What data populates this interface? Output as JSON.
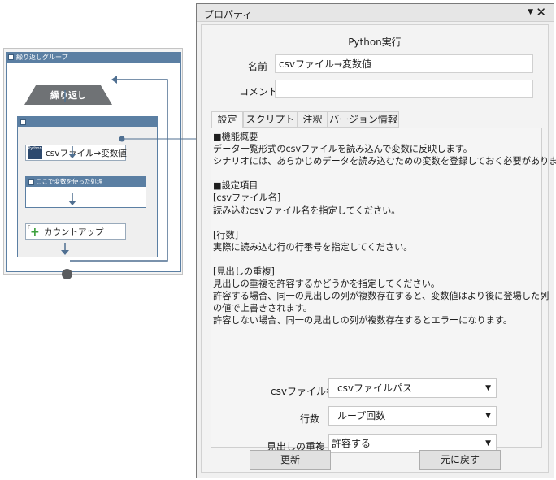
{
  "flow": {
    "group_title": "繰り返しグループ",
    "loop_label": "繰り返し",
    "python_icon_label": "Python",
    "csv_node_label": "csvファイル→変数値",
    "sub_block_title": "ここで変数を使った処理",
    "count_node_label": "カウントアップ"
  },
  "panel": {
    "title": "プロパティ",
    "dropdown_icon": "▼",
    "close_icon": "✕",
    "action_name": "Python実行",
    "name_label": "名前",
    "name_value": "csvファイル→変数値",
    "comment_label": "コメント",
    "comment_value": ""
  },
  "tabs": [
    {
      "label": "設定",
      "active": true
    },
    {
      "label": "スクリプト",
      "active": false
    },
    {
      "label": "注釈",
      "active": false
    },
    {
      "label": "バージョン情報",
      "active": false
    }
  ],
  "description": [
    "■機能概要",
    "データ一覧形式のcsvファイルを読み込んで変数に反映します。",
    "シナリオには、あらかじめデータを読み込むための変数を登録しておく必要があります。",
    "",
    "■設定項目",
    "[csvファイル名]",
    "読み込むcsvファイル名を指定してください。",
    "",
    "[行数]",
    "実際に読み込む行の行番号を指定してください。",
    "",
    "[見出しの重複]",
    "見出しの重複を許容するかどうかを指定してください。",
    "許容する場合、同一の見出しの列が複数存在すると、変数値はより後に登場した列",
    "の値で上書きされます。",
    "許容しない場合、同一の見出しの列が複数存在するとエラーになります。"
  ],
  "settings": {
    "csv_label": "csvファイル名",
    "csv_value": "csvファイルパス",
    "rows_label": "行数",
    "rows_value": "ループ回数",
    "dup_label": "見出しの重複",
    "dup_value": "許容する",
    "caret": "▼"
  },
  "buttons": {
    "update": "更新",
    "revert": "元に戻す"
  },
  "colors": {
    "group_header": "#5b7fa3",
    "loop_node": "#6f7275",
    "connector": "#4f6f91",
    "count_plus": "#3ca03c"
  }
}
